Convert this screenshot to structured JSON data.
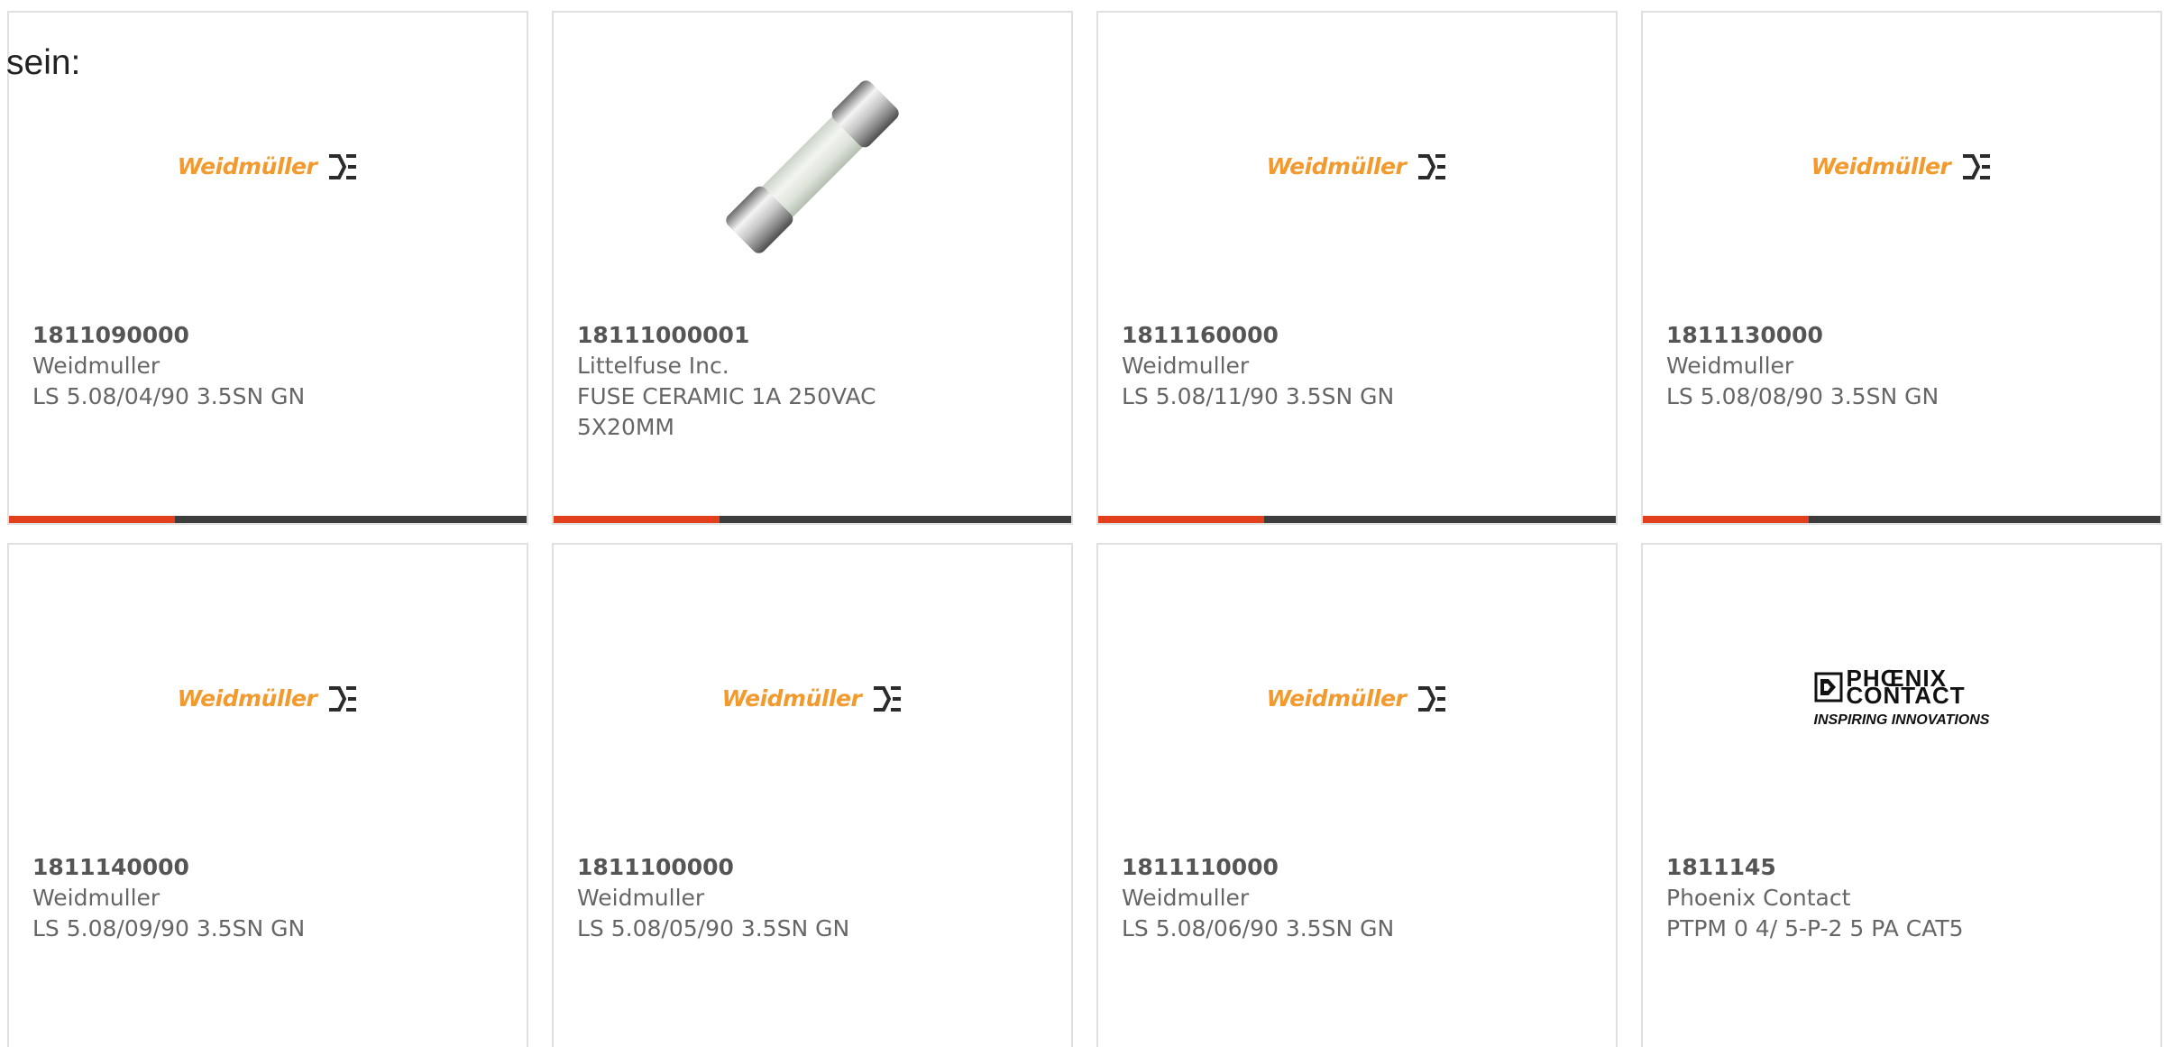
{
  "intro_text": "sein:",
  "colors": {
    "accent": "#e2401c",
    "bar-dark": "#3d3d3d",
    "weidmuller-orange": "#f29a2e",
    "text-strong": "#555555",
    "text": "#666666",
    "border": "#e0e0e0"
  },
  "products": [
    {
      "part_number": "1811090000",
      "manufacturer": "Weidmuller",
      "description": "LS 5.08/04/90 3.5SN GN",
      "image": {
        "icon": "weidmuller-logo",
        "text": "Weidmüller"
      }
    },
    {
      "part_number": "18111000001",
      "manufacturer": "Littelfuse Inc.",
      "description": "FUSE CERAMIC 1A 250VAC 5X20MM",
      "image": {
        "icon": "ceramic-fuse-photo"
      }
    },
    {
      "part_number": "1811160000",
      "manufacturer": "Weidmuller",
      "description": "LS 5.08/11/90 3.5SN GN",
      "image": {
        "icon": "weidmuller-logo",
        "text": "Weidmüller"
      }
    },
    {
      "part_number": "1811130000",
      "manufacturer": "Weidmuller",
      "description": "LS 5.08/08/90 3.5SN GN",
      "image": {
        "icon": "weidmuller-logo",
        "text": "Weidmüller"
      }
    },
    {
      "part_number": "1811140000",
      "manufacturer": "Weidmuller",
      "description": "LS 5.08/09/90 3.5SN GN",
      "image": {
        "icon": "weidmuller-logo",
        "text": "Weidmüller"
      }
    },
    {
      "part_number": "1811100000",
      "manufacturer": "Weidmuller",
      "description": "LS 5.08/05/90 3.5SN GN",
      "image": {
        "icon": "weidmuller-logo",
        "text": "Weidmüller"
      }
    },
    {
      "part_number": "1811110000",
      "manufacturer": "Weidmuller",
      "description": "LS 5.08/06/90 3.5SN GN",
      "image": {
        "icon": "weidmuller-logo",
        "text": "Weidmüller"
      }
    },
    {
      "part_number": "1811145",
      "manufacturer": "Phoenix Contact",
      "description": "PTPM 0 4/ 5-P-2 5 PA CAT5",
      "image": {
        "icon": "phoenix-contact-logo",
        "lines": [
          "PHŒNIX",
          "CONTACT"
        ],
        "tagline": "INSPIRING INNOVATIONS"
      }
    }
  ]
}
